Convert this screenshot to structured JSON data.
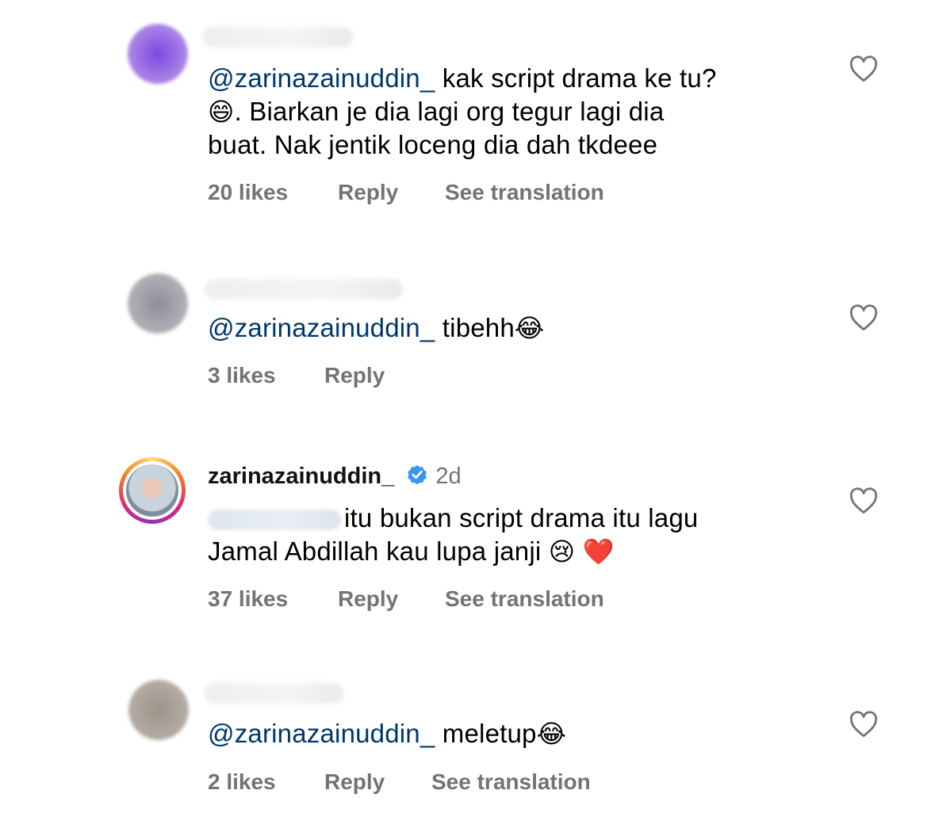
{
  "comments": [
    {
      "mention": "@zarinazainuddin_",
      "text_line1": " kak script drama ke tu?",
      "text_line2": ". Biarkan je dia lagi org tegur lagi dia",
      "text_line3": "buat. Nak jentik loceng dia dah tkdeee",
      "emoji": "😄",
      "likes": "20 likes",
      "reply": "Reply",
      "translate": "See translation",
      "avatar_color": "#8a5ad6"
    },
    {
      "mention": "@zarinazainuddin_",
      "text": " tibehh",
      "emoji": "😂",
      "likes": "3 likes",
      "reply": "Reply",
      "avatar_color": "#9a98a0"
    },
    {
      "username": "zarinazainuddin_",
      "time": "2d",
      "text_line1": "itu bukan script drama itu lagu",
      "text_line2": "Jamal Abdillah kau lupa janji ",
      "emoji1": "😢",
      "emoji2": "❤️",
      "likes": "37 likes",
      "reply": "Reply",
      "translate": "See translation",
      "verified_color": "#3897f0"
    },
    {
      "mention": "@zarinazainuddin_",
      "text": " meletup",
      "emoji": "😂",
      "likes": "2 likes",
      "reply": "Reply",
      "translate": "See translation",
      "avatar_color": "#a59c92"
    }
  ],
  "icons": {
    "like": "heart-outline-icon",
    "verified": "verified-badge-icon"
  }
}
